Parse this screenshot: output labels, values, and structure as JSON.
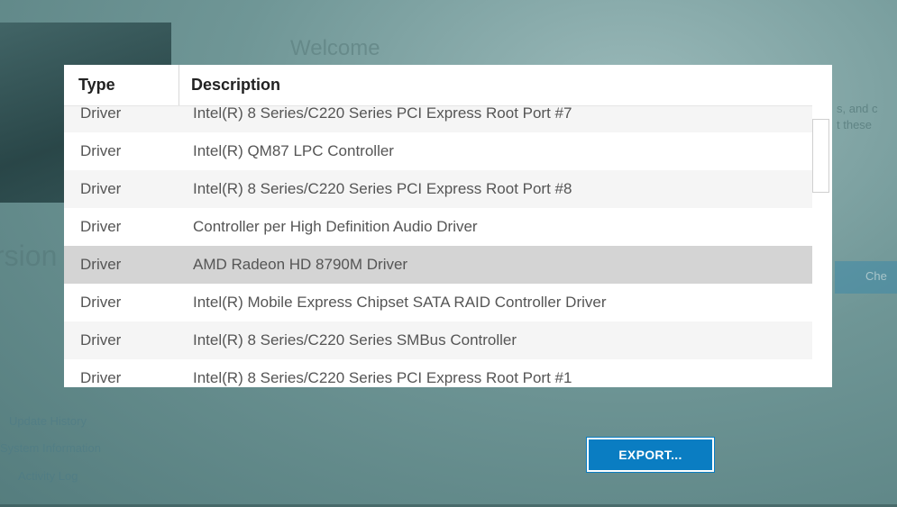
{
  "background": {
    "welcome_text": "Welcome",
    "version_text": "rsion",
    "right_text_lines": [
      "s, and c",
      "t these"
    ],
    "blue_button_text": "Che",
    "links": [
      "Update History",
      "System Information",
      "Activity Log"
    ]
  },
  "table": {
    "columns": {
      "type": "Type",
      "description": "Description"
    },
    "rows": [
      {
        "type": "Driver",
        "description": "Intel(R) 8 Series/C220 Series PCI Express Root Port #7"
      },
      {
        "type": "Driver",
        "description": "Intel(R) QM87 LPC Controller"
      },
      {
        "type": "Driver",
        "description": "Intel(R) 8 Series/C220 Series PCI Express Root Port #8"
      },
      {
        "type": "Driver",
        "description": "Controller per High Definition Audio Driver"
      },
      {
        "type": "Driver",
        "description": "AMD Radeon HD 8790M Driver"
      },
      {
        "type": "Driver",
        "description": "Intel(R) Mobile Express Chipset SATA RAID Controller Driver"
      },
      {
        "type": "Driver",
        "description": "Intel(R) 8 Series/C220 Series SMBus Controller"
      },
      {
        "type": "Driver",
        "description": "Intel(R) 8 Series/C220 Series PCI Express Root Port #1"
      }
    ],
    "selected_row_index": 4
  },
  "export_button": {
    "label": "EXPORT..."
  },
  "colors": {
    "accent": "#0a7dc2",
    "selected_row": "#d4d4d4"
  }
}
